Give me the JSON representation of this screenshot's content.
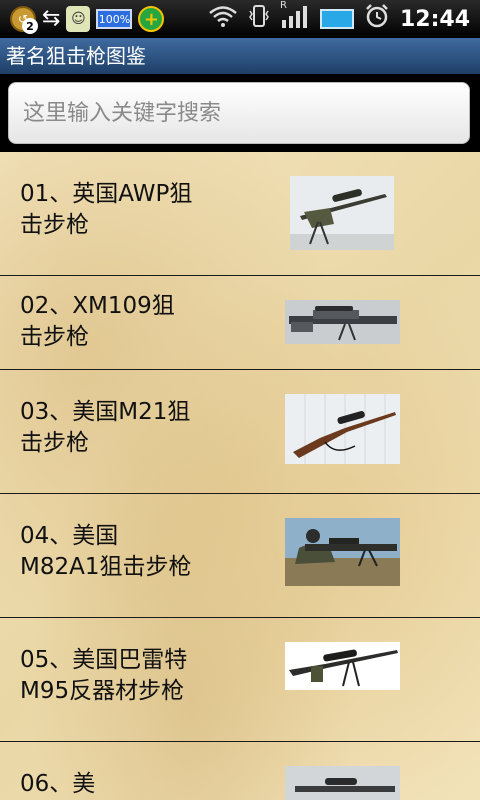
{
  "status_bar": {
    "notification_count": "2",
    "battery_mini_label": "100%",
    "signal_label": "R",
    "time": "12:44"
  },
  "app": {
    "title": "著名狙击枪图鉴"
  },
  "search": {
    "placeholder": "这里输入关键字搜索"
  },
  "list": {
    "items": [
      {
        "label": "01、英国AWP狙击步枪",
        "image": "sniper-rifle-photo"
      },
      {
        "label": "02、XM109狙击步枪",
        "image": "sniper-rifle-photo"
      },
      {
        "label": "03、美国M21狙击步枪",
        "image": "sniper-rifle-photo"
      },
      {
        "label": "04、美国M82A1狙击步枪",
        "image": "sniper-rifle-photo"
      },
      {
        "label": "05、美国巴雷特M95反器材步枪",
        "image": "sniper-rifle-photo"
      },
      {
        "label": "06、美",
        "image": "sniper-rifle-photo"
      }
    ]
  },
  "colors": {
    "title_bar": "#2c5282",
    "list_background": "#f0dfb3",
    "divider": "#1a1a1a"
  }
}
